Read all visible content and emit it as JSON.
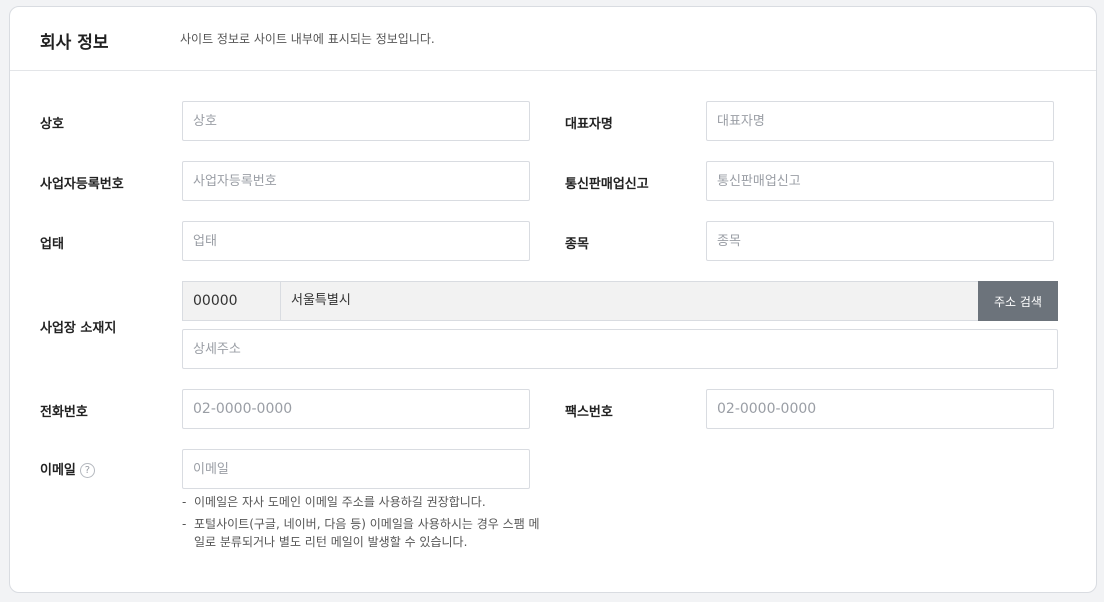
{
  "section": {
    "title": "회사 정보",
    "description": "사이트 정보로 사이트 내부에 표시되는 정보입니다."
  },
  "fields": {
    "company_name": {
      "label": "상호",
      "placeholder": "상호"
    },
    "ceo_name": {
      "label": "대표자명",
      "placeholder": "대표자명"
    },
    "business_reg_no": {
      "label": "사업자등록번호",
      "placeholder": "사업자등록번호"
    },
    "ecommerce_report": {
      "label": "통신판매업신고",
      "placeholder": "통신판매업신고"
    },
    "business_type": {
      "label": "업태",
      "placeholder": "업태"
    },
    "business_item": {
      "label": "종목",
      "placeholder": "종목"
    },
    "address": {
      "label": "사업장 소재지",
      "zipcode": "00000",
      "main": "서울특별시",
      "search_button": "주소 검색",
      "detail_placeholder": "상세주소"
    },
    "phone": {
      "label": "전화번호",
      "placeholder": "02-0000-0000"
    },
    "fax": {
      "label": "팩스번호",
      "placeholder": "02-0000-0000"
    },
    "email": {
      "label": "이메일",
      "help_icon": "?",
      "placeholder": "이메일",
      "notes": [
        "이메일은 자사 도메인 이메일 주소를 사용하길 권장합니다.",
        "포털사이트(구글, 네이버, 다음 등) 이메일을 사용하시는 경우 스팸 메일로 분류되거나 별도 리턴 메일이 발생할 수 있습니다."
      ]
    }
  }
}
